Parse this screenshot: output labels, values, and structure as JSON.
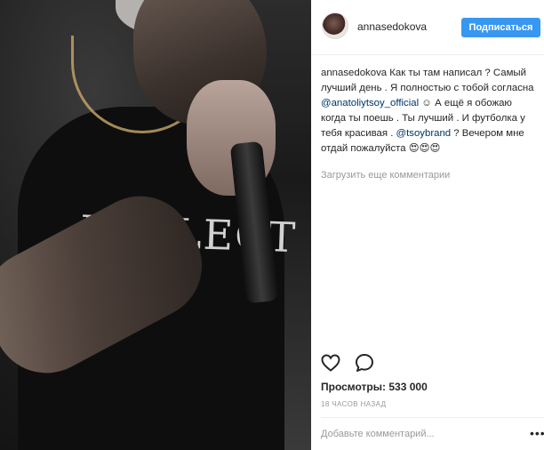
{
  "post": {
    "photo_print_text": "REFLECT"
  },
  "header": {
    "username": "annasedokova",
    "follow_label": "Подписаться"
  },
  "caption": {
    "author": "annasedokova",
    "text_1": " Как ты там написал ? Самый лучший день . Я полностью с тобой согласна ",
    "mention_1": "@anatoliytsoy_official",
    "text_2": " ☺ А ещё я обожаю когда ты поешь . Ты лучший . И футболка у тебя красивая . ",
    "mention_2": "@tsoybrand",
    "text_3": " ? Вечером мне отдай пожалуйста 😍😍😍"
  },
  "comments": {
    "load_more_label": "Загрузить еще комментарии"
  },
  "actions": {
    "like_icon": "heart-icon",
    "comment_icon": "comment-icon"
  },
  "stats": {
    "views_label": "Просмотры:",
    "views_value": "533 000",
    "time_ago": "18 ЧАСОВ НАЗАД"
  },
  "composer": {
    "placeholder": "Добавьте комментарий...",
    "more_icon": "more-options-icon"
  },
  "colors": {
    "accent": "#3897f0",
    "mention": "#003569",
    "muted": "#999999",
    "border": "#efefef"
  }
}
